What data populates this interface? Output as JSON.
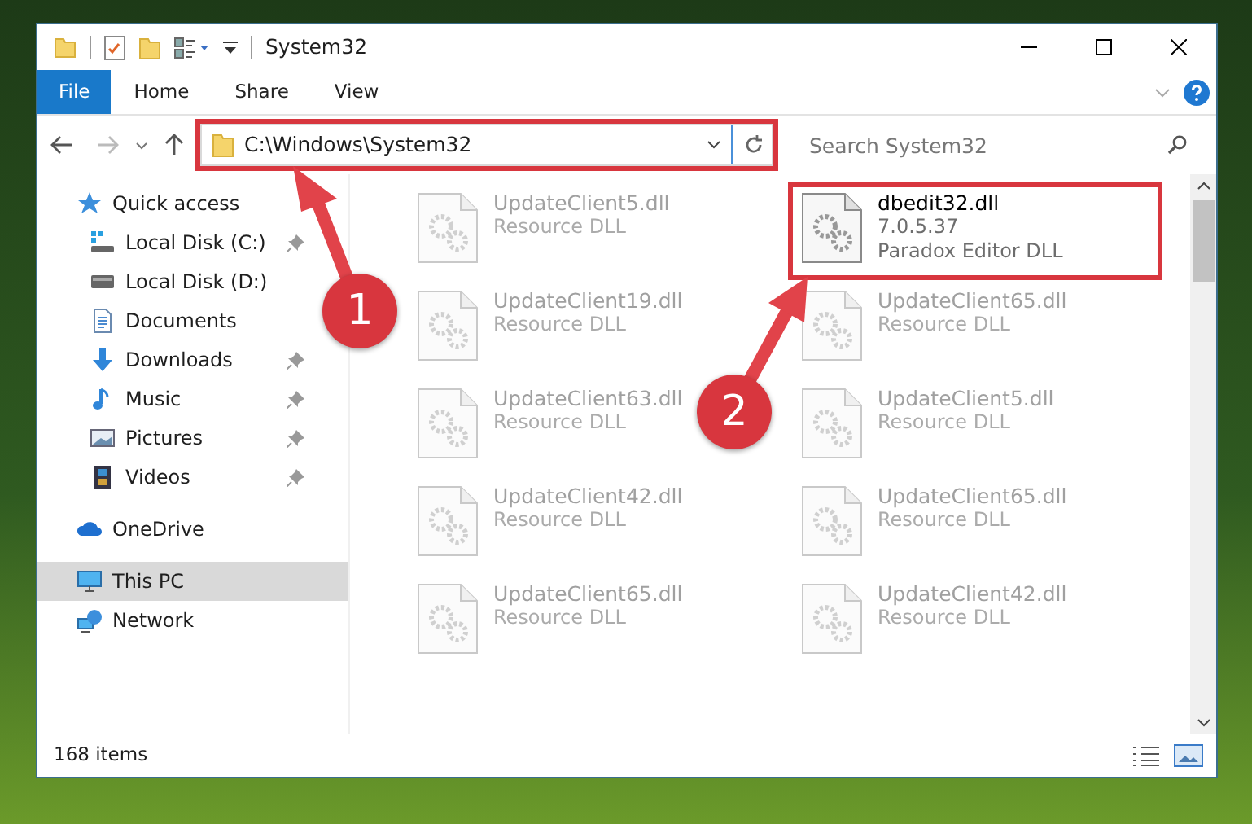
{
  "window": {
    "title": "System32"
  },
  "ribbon": {
    "tabs": [
      {
        "label": "File",
        "kind": "app"
      },
      {
        "label": "Home",
        "kind": "tab"
      },
      {
        "label": "Share",
        "kind": "tab"
      },
      {
        "label": "View",
        "kind": "tab"
      }
    ]
  },
  "address": {
    "path": "C:\\Windows\\System32",
    "highlighted": true
  },
  "search": {
    "placeholder": "Search System32"
  },
  "nav": [
    {
      "label": "Quick access",
      "kind": "star",
      "selected": false,
      "children": [
        {
          "label": "Local Disk (C:)",
          "kind": "windrive",
          "pinned": true,
          "selected": false
        },
        {
          "label": "Local Disk (D:)",
          "kind": "drive",
          "pinned": false,
          "selected": false
        },
        {
          "label": "Documents",
          "kind": "documents",
          "pinned": false,
          "selected": false
        },
        {
          "label": "Downloads",
          "kind": "downloads",
          "pinned": true,
          "selected": false
        },
        {
          "label": "Music",
          "kind": "music",
          "pinned": true,
          "selected": false
        },
        {
          "label": "Pictures",
          "kind": "pictures",
          "pinned": true,
          "selected": false
        },
        {
          "label": "Videos",
          "kind": "videos",
          "pinned": true,
          "selected": false
        }
      ]
    },
    {
      "label": "OneDrive",
      "kind": "cloud",
      "selected": false
    },
    {
      "label": "This PC",
      "kind": "computer",
      "selected": true
    },
    {
      "label": "Network",
      "kind": "network",
      "selected": false
    }
  ],
  "files": [
    {
      "name": "UpdateClient5.dll",
      "details": [
        "Resource DLL"
      ],
      "faded": true,
      "highlighted": false
    },
    {
      "name": "dbedit32.dll",
      "details": [
        "7.0.5.37",
        "Paradox Editor DLL"
      ],
      "faded": false,
      "highlighted": true
    },
    {
      "name": "UpdateClient19.dll",
      "details": [
        "Resource DLL"
      ],
      "faded": true,
      "highlighted": false
    },
    {
      "name": "UpdateClient65.dll",
      "details": [
        "Resource DLL"
      ],
      "faded": true,
      "highlighted": false
    },
    {
      "name": "UpdateClient63.dll",
      "details": [
        "Resource DLL"
      ],
      "faded": true,
      "highlighted": false
    },
    {
      "name": "UpdateClient5.dll",
      "details": [
        "Resource DLL"
      ],
      "faded": true,
      "highlighted": false
    },
    {
      "name": "UpdateClient42.dll",
      "details": [
        "Resource DLL"
      ],
      "faded": true,
      "highlighted": false
    },
    {
      "name": "UpdateClient65.dll",
      "details": [
        "Resource DLL"
      ],
      "faded": true,
      "highlighted": false
    },
    {
      "name": "UpdateClient65.dll",
      "details": [
        "Resource DLL"
      ],
      "faded": true,
      "highlighted": false
    },
    {
      "name": "UpdateClient42.dll",
      "details": [
        "Resource DLL"
      ],
      "faded": true,
      "highlighted": false
    }
  ],
  "status_bar": {
    "count": "168 items"
  },
  "annotations": [
    {
      "number": "1"
    },
    {
      "number": "2"
    }
  ]
}
